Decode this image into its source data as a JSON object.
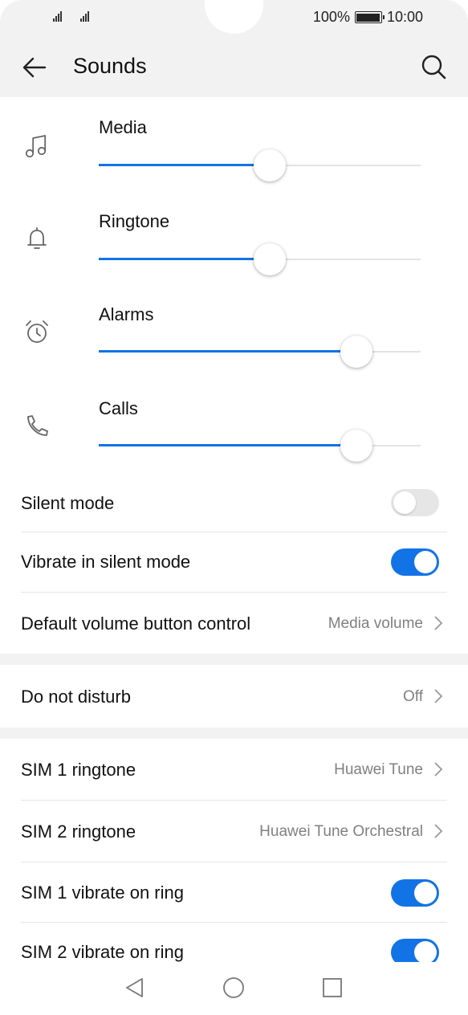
{
  "status": {
    "battery": "100%",
    "time": "10:00"
  },
  "header": {
    "title": "Sounds"
  },
  "volumes": [
    {
      "label": "Media",
      "level": 0.53,
      "icon": "music-note-icon"
    },
    {
      "label": "Ringtone",
      "level": 0.53,
      "icon": "bell-icon"
    },
    {
      "label": "Alarms",
      "level": 0.8,
      "icon": "alarm-clock-icon"
    },
    {
      "label": "Calls",
      "level": 0.8,
      "icon": "phone-icon"
    }
  ],
  "settings": {
    "silent_mode": {
      "label": "Silent mode",
      "on": false
    },
    "vibrate_silent": {
      "label": "Vibrate in silent mode",
      "on": true
    },
    "default_volume": {
      "label": "Default volume button control",
      "value": "Media volume"
    },
    "dnd": {
      "label": "Do not disturb",
      "value": "Off"
    },
    "sim1_ringtone": {
      "label": "SIM 1 ringtone",
      "value": "Huawei Tune"
    },
    "sim2_ringtone": {
      "label": "SIM 2 ringtone",
      "value": "Huawei Tune Orchestral"
    },
    "sim1_vibrate": {
      "label": "SIM 1 vibrate on ring",
      "on": true
    },
    "sim2_vibrate": {
      "label": "SIM 2 vibrate on ring",
      "on": true
    }
  },
  "colors": {
    "accent": "#1273e6",
    "background": "#ffffff",
    "toolbar": "#f2f2f2"
  }
}
